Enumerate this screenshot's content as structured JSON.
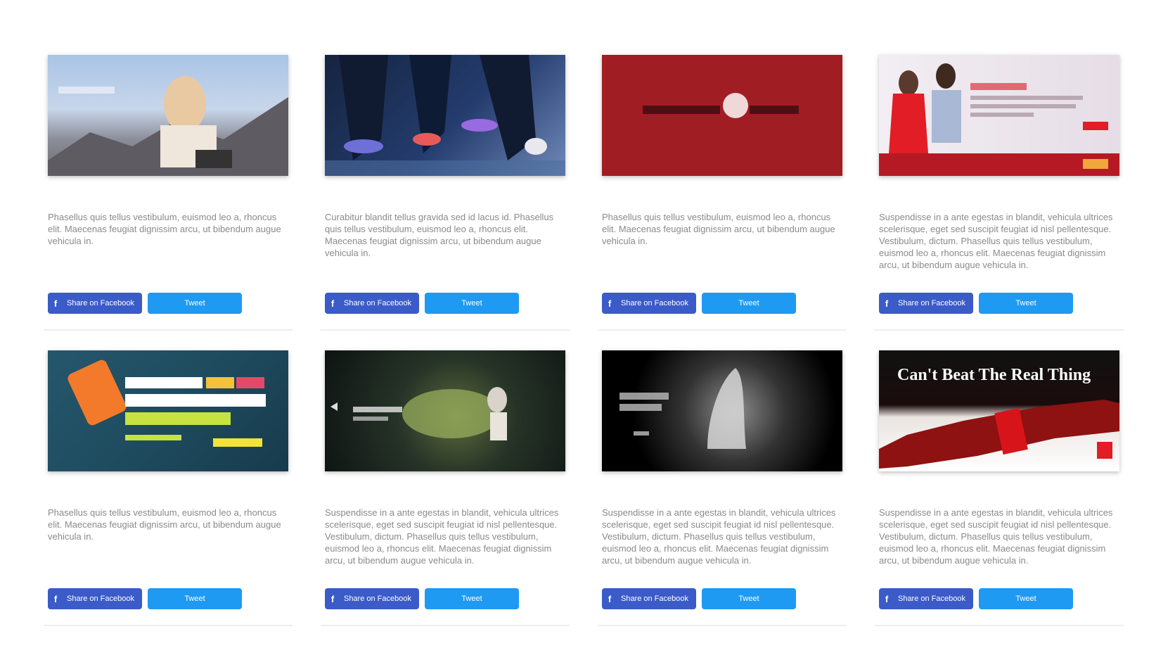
{
  "cards": [
    {
      "banner_text": "",
      "description": "Phasellus quis tellus vestibulum, euismod leo a, rhoncus elit. Maecenas feugiat dignissim arcu, ut bibendum augue vehicula in.",
      "fb_label": "Share on Facebook",
      "tw_label": "Tweet"
    },
    {
      "banner_text": "",
      "description": "Curabitur blandit tellus gravida sed id lacus id. Phasellus quis tellus vestibulum, euismod leo a, rhoncus elit. Maecenas feugiat dignissim arcu, ut bibendum augue vehicula in.",
      "fb_label": "Share on Facebook",
      "tw_label": "Tweet"
    },
    {
      "banner_text": "",
      "description": "Phasellus quis tellus vestibulum, euismod leo a, rhoncus elit. Maecenas feugiat dignissim arcu, ut bibendum augue vehicula in.",
      "fb_label": "Share on Facebook",
      "tw_label": "Tweet"
    },
    {
      "banner_text": "",
      "description": "Suspendisse in a ante egestas in blandit, vehicula ultrices scelerisque, eget sed suscipit feugiat id nisl pellentesque. Vestibulum, dictum. Phasellus quis tellus vestibulum, euismod leo a, rhoncus elit. Maecenas feugiat dignissim arcu, ut bibendum augue vehicula in.",
      "fb_label": "Share on Facebook",
      "tw_label": "Tweet"
    },
    {
      "banner_text": "",
      "description": "Phasellus quis tellus vestibulum, euismod leo a, rhoncus elit. Maecenas feugiat dignissim arcu, ut bibendum augue vehicula in.",
      "fb_label": "Share on Facebook",
      "tw_label": "Tweet"
    },
    {
      "banner_text": "",
      "description": "Suspendisse in a ante egestas in blandit, vehicula ultrices scelerisque, eget sed suscipit feugiat id nisl pellentesque. Vestibulum, dictum. Phasellus quis tellus vestibulum, euismod leo a, rhoncus elit. Maecenas feugiat dignissim arcu, ut bibendum augue vehicula in.",
      "fb_label": "Share on Facebook",
      "tw_label": "Tweet"
    },
    {
      "banner_text": "",
      "description": "Suspendisse in a ante egestas in blandit, vehicula ultrices scelerisque, eget sed suscipit feugiat id nisl pellentesque. Vestibulum, dictum. Phasellus quis tellus vestibulum, euismod leo a, rhoncus elit. Maecenas feugiat dignissim arcu, ut bibendum augue vehicula in.",
      "fb_label": "Share on Facebook",
      "tw_label": "Tweet"
    },
    {
      "banner_text": "Can't Beat The Real Thing",
      "description": "Suspendisse in a ante egestas in blandit, vehicula ultrices scelerisque, eget sed suscipit feugiat id nisl pellentesque. Vestibulum, dictum. Phasellus quis tellus vestibulum, euismod leo a, rhoncus elit. Maecenas feugiat dignissim arcu, ut bibendum augue vehicula in.",
      "fb_label": "Share on Facebook",
      "tw_label": "Tweet"
    }
  ],
  "colors": {
    "facebook": "#3b5bc9",
    "twitter": "#1e9af2",
    "description_text": "#8a8a8a"
  },
  "icons": {
    "facebook": "facebook-icon"
  }
}
